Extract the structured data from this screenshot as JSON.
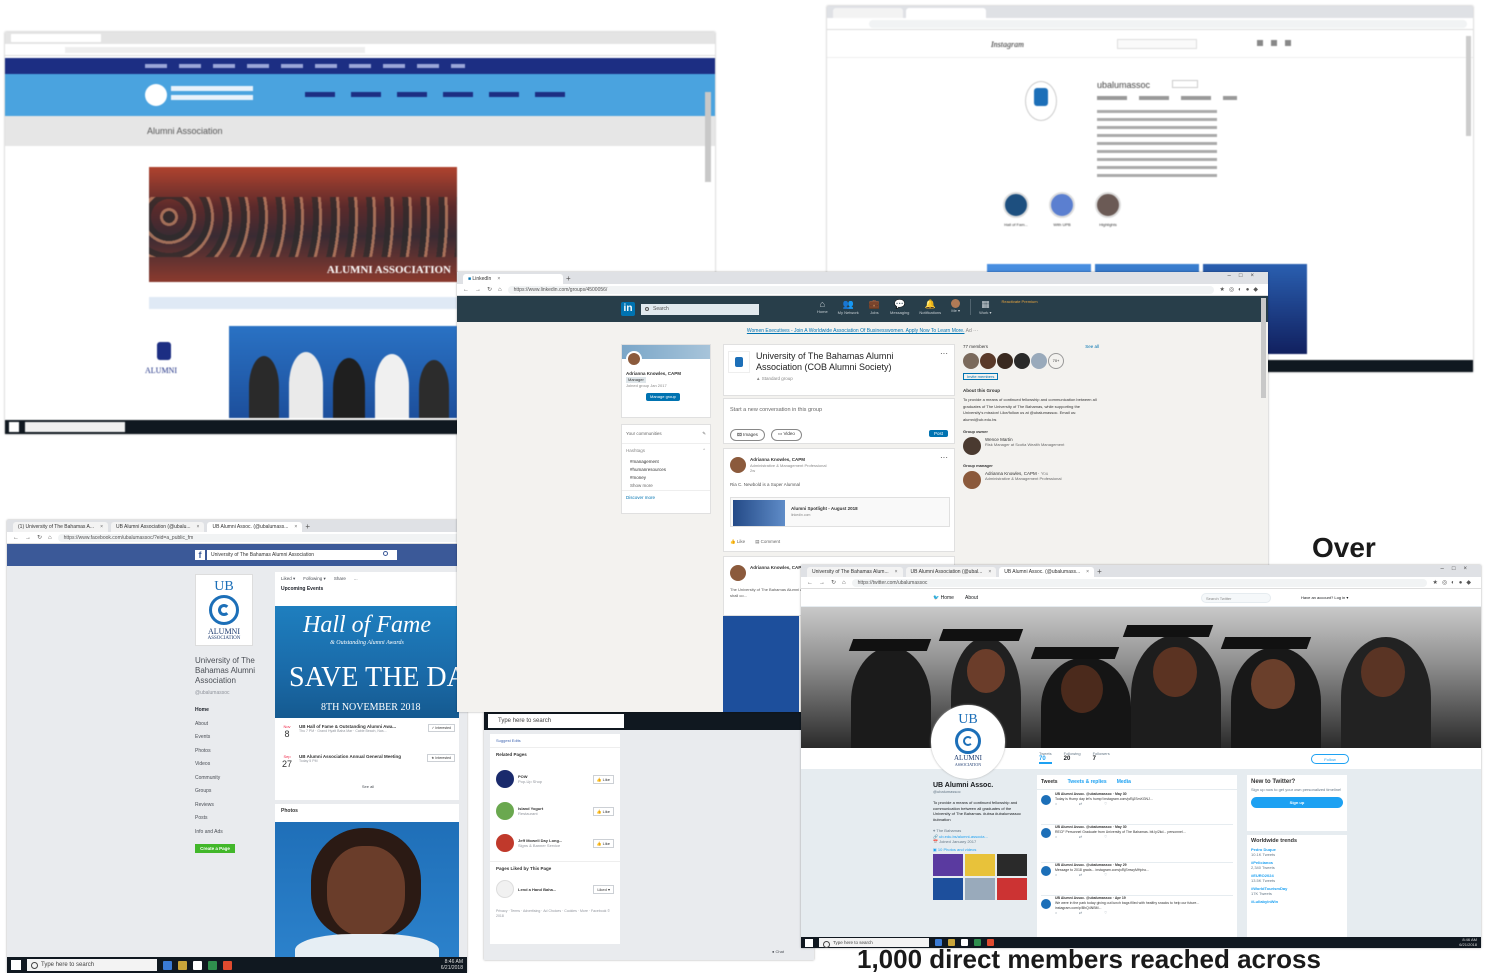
{
  "captions": {
    "over": "Over",
    "bottom": "1,000 direct members reached across"
  },
  "colors": {
    "linkedin": "#283e4a",
    "linkedin_blue": "#0073b1",
    "facebook": "#3b5998",
    "ub_blue": "#4aa3df",
    "twitter_blue": "#1da1f2",
    "navy": "#1c2e83"
  },
  "ub_site": {
    "heading": "Alumni Association",
    "banner_text": "ALUMNI ASSOCIATION",
    "logo_text": "ALUMNI"
  },
  "instagram": {
    "brand": "Instagram",
    "username": "ubalumassoc",
    "highlights": [
      "Hall of Fam...",
      "With UPB",
      "Highlights"
    ]
  },
  "linkedin": {
    "tab": "LinkedIn",
    "url": "https://www.linkedin.com/groups/4500056/",
    "search": "Search",
    "nav": [
      "Home",
      "My Network",
      "Jobs",
      "Messaging",
      "Notifications",
      "Me ▾",
      "Work ▾",
      "Reactivate Premium"
    ],
    "ad": "Women Executives - Join A Worldwide Association Of Businesswomen. Apply Now To Learn More.",
    "ad_tag": "Ad",
    "profile_name": "Adrianna Knowles, CAPM",
    "profile_role": "Manager",
    "profile_joined": "Joined group Jan 2017",
    "manage_group": "Manage group",
    "your_communities": "Your communities",
    "hashtags_label": "Hashtags",
    "hashtags": [
      "#management",
      "#humanresources",
      "#money"
    ],
    "show_more": "Show more",
    "discover_more": "Discover more",
    "group_title": "University of The Bahamas Alumni Association (COB Alumni Society)",
    "standard_group": "Standard group",
    "start_convo": "Start a new conversation in this group",
    "images": "Images",
    "video": "Video",
    "post": "Post",
    "poster_name": "Adrianna Knowles, CAPM",
    "poster_role": "Administrative & Management Professional",
    "poster_time": "2w",
    "like_note": "Ria C. Newbold is a Super Alumnal",
    "spotlight": "Alumni Spotlight - August 2018",
    "spotlight_src": "linkedin.com",
    "like": "Like",
    "comment": "Comment",
    "second_post_text": "The University of The Bahamas Alumni Association ... Meeting, which is open to members, which shall co...",
    "members_count": "77 members",
    "see_all": "See all",
    "more_members": "70+",
    "invite": "Invite members",
    "about_title": "About this Group",
    "about_text": "To provide a means of continued fellowship and communication between all graduates of The University of The Bahamas, while supporting the University's mission! Like/follow us at @ubalumassoc. Email us: alumni@ub.edu.bs",
    "owner_label": "Group owner",
    "owner_name": "Wence Martin",
    "owner_role": "Risk Manager at Scotia Wealth Management",
    "manager_label": "Group manager",
    "manager_name": "Adrianna Knowles, CAPM",
    "manager_role": "Administrative & Management Professional",
    "you": "You"
  },
  "facebook": {
    "tabs": [
      "(1) University of The Bahamas A...",
      "UB Alumni Association (@ubalu...",
      "UB Alumni Assoc. (@ubalumass..."
    ],
    "url": "https://www.facebook.com/ubalumassoc/?eid=a_public_fm",
    "search_placeholder": "University of The Bahamas Alumni Association",
    "page_name": "University of The Bahamas Alumni Association",
    "handle": "@ubalumassoc",
    "logo_ub": "UB",
    "logo_text": "ALUMNI",
    "logo_sub": "ASSOCIATION",
    "menu": [
      "Home",
      "About",
      "Events",
      "Photos",
      "Videos",
      "Community",
      "Groups",
      "Reviews",
      "Posts",
      "Info and Ads"
    ],
    "create_page": "Create a Page",
    "actions": [
      "Liked ▾",
      "Following ▾",
      "Share",
      "..."
    ],
    "upcoming": "Upcoming Events",
    "hof_line1": "Hall of Fame",
    "hof_line2": "& Outstanding Alumni Awards",
    "save_the_date": "SAVE THE DATE",
    "event_date": "8TH NOVEMBER 2018",
    "events": [
      {
        "month": "Nov",
        "day": "8",
        "title": "UB Hall of Fame & Outstanding Alumni Awa...",
        "sub": "Thu 7 PM · Grand Hyatt Baha Mar · Cable Beach, Nas...",
        "action": "Interested"
      },
      {
        "month": "Sep",
        "day": "27",
        "title": "UB Alumni Association Annual General Meeting",
        "sub": "Today 5 PM",
        "action": "Interested"
      }
    ],
    "see_all": "See all",
    "photos": "Photos",
    "suggest_edits": "Suggest Edits",
    "related_pages": "Related Pages",
    "related": [
      {
        "name": "POW",
        "sub": "Pop-Up Shop",
        "action": "Like"
      },
      {
        "name": "Island Yogurt",
        "sub": "Restaurant",
        "action": "Like"
      },
      {
        "name": "Jeff Mowell Day Long...",
        "sub": "Signs & Banner Service",
        "action": "Like"
      }
    ],
    "liked_by": "Pages Liked by This Page",
    "liked_page": "Lend a Hand Baha...",
    "liked_action": "Liked ▾",
    "footer": "Privacy · Terms · Advertising · Ad Choices · Cookies · More · Facebook © 2018",
    "chat": "Chat",
    "taskbar_search": "Type here to search"
  },
  "twitter": {
    "tabs": [
      "University of The Bahamas Alum...",
      "UB Alumni Association (@ubal...",
      "UB Alumni Assoc. (@ubalumass..."
    ],
    "url": "https://twitter.com/ubalumassoc",
    "nav_home": "Home",
    "nav_about": "About",
    "search": "Search Twitter",
    "login": "Have an account? Log in ▾",
    "logo_ub": "UB",
    "logo_text": "ALUMNI",
    "logo_sub": "ASSOCIATION",
    "stats": [
      {
        "label": "Tweets",
        "value": "70"
      },
      {
        "label": "Following",
        "value": "20"
      },
      {
        "label": "Followers",
        "value": "7"
      }
    ],
    "follow": "Follow",
    "name": "UB Alumni Assoc.",
    "handle": "@ubalumassoc",
    "bio": "To provide a means of continued fellowship and communication between all graduates of the University of The Bahamas. #ubsa #ubalumassoc #ubnation",
    "location": "The Bahamas",
    "website": "ub.edu.bs/alumni-associa...",
    "joined": "Joined January 2017",
    "photos_link": "10 Photos and videos",
    "tweet_tabs": [
      "Tweets",
      "Tweets & replies",
      "Media"
    ],
    "tweets": [
      {
        "head": "UB Alumni Assoc. @ubalumassoc · May 30",
        "text": "Today is Hump day let's hump! instagram.com/p/BjJSmXGNJ..."
      },
      {
        "head": "UB Alumni Assoc. @ubalumassoc · May 30",
        "text": "RECF Personnel Graduate from University of The Bahamas. bit.ly/2kd... personnel..."
      },
      {
        "head": "UB Alumni Assoc. @ubalumassoc · May 29",
        "text": "Message to 2018 grads... instagram.com/p/BjSmwyMHpho..."
      },
      {
        "head": "UB Alumni Assoc. @ubalumassoc · Apr 19",
        "text": "We were in the park today giving out lunch bags filled with healthy snacks to help our future... instagram.com/p/BhQ4NBM..."
      }
    ],
    "new_title": "New to Twitter?",
    "new_text": "Sign up now to get your own personalized timeline!",
    "signup": "Sign up",
    "trends_title": "Worldwide trends",
    "trends": [
      {
        "tag": "Pedro Duque",
        "count": "10.1K Tweets"
      },
      {
        "tag": "#Pelicianos",
        "count": "2,340 Tweets"
      },
      {
        "tag": "#EURO2024",
        "count": "13.5K Tweets"
      },
      {
        "tag": "#WorldTourismDay",
        "count": "17K Tweets"
      },
      {
        "tag": "#LullabyInWin",
        "count": ""
      }
    ],
    "taskbar_search": "Type here to search",
    "clock_time": "8:46 AM",
    "clock_date": "6/21/2018"
  },
  "clock_fb": {
    "time": "8:46 AM",
    "date": "6/21/2018"
  }
}
